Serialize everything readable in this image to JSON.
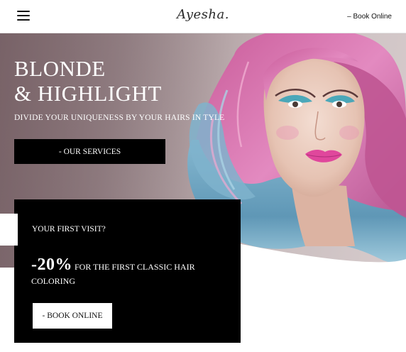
{
  "header": {
    "logo": "Ayesha.",
    "book_link": "– Book Online"
  },
  "hero": {
    "title_line1": "BLONDE",
    "title_line2": "& HIGHLIGHT",
    "subtitle": "DIVIDE YOUR UNIQUENESS BY YOUR HAIRS IN TYLE",
    "services_button": "- OUR SERVICES"
  },
  "offer": {
    "question": "YOUR FIRST VISIT?",
    "discount": "-20%",
    "description": "FOR THE FIRST CLASSIC HAIR COLORING",
    "button": "- BOOK ONLINE"
  },
  "icons": {
    "menu": "hamburger-menu-icon"
  },
  "colors": {
    "dark": "#000000",
    "light": "#ffffff",
    "hair_pink": "#d36aa6",
    "hair_blue": "#6fa9c6"
  }
}
